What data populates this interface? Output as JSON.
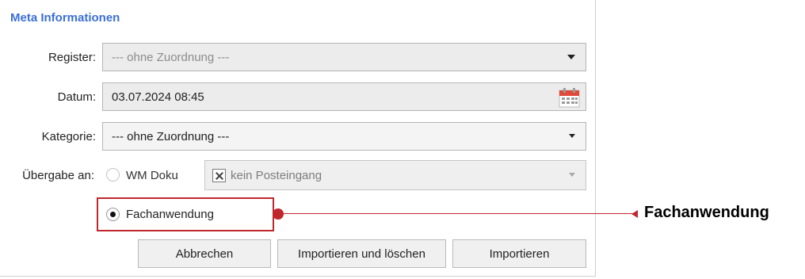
{
  "panel": {
    "title": "Meta Informationen"
  },
  "register": {
    "label": "Register:",
    "value": "--- ohne Zuordnung ---"
  },
  "datum": {
    "label": "Datum:",
    "value": "03.07.2024 08:45"
  },
  "kategorie": {
    "label": "Kategorie:",
    "value": "--- ohne Zuordnung ---"
  },
  "uebergabe": {
    "label": "Übergabe an:",
    "options": [
      {
        "label": "WM Doku",
        "selected": false
      },
      {
        "label": "Fachanwendung",
        "selected": true
      }
    ],
    "posteingang": "kein Posteingang"
  },
  "buttons": {
    "cancel": "Abbrechen",
    "import_delete": "Importieren und löschen",
    "import": "Importieren"
  },
  "annotation": {
    "label": "Fachanwendung",
    "color": "#c0272d"
  },
  "colors": {
    "title": "#3b6fd6"
  }
}
